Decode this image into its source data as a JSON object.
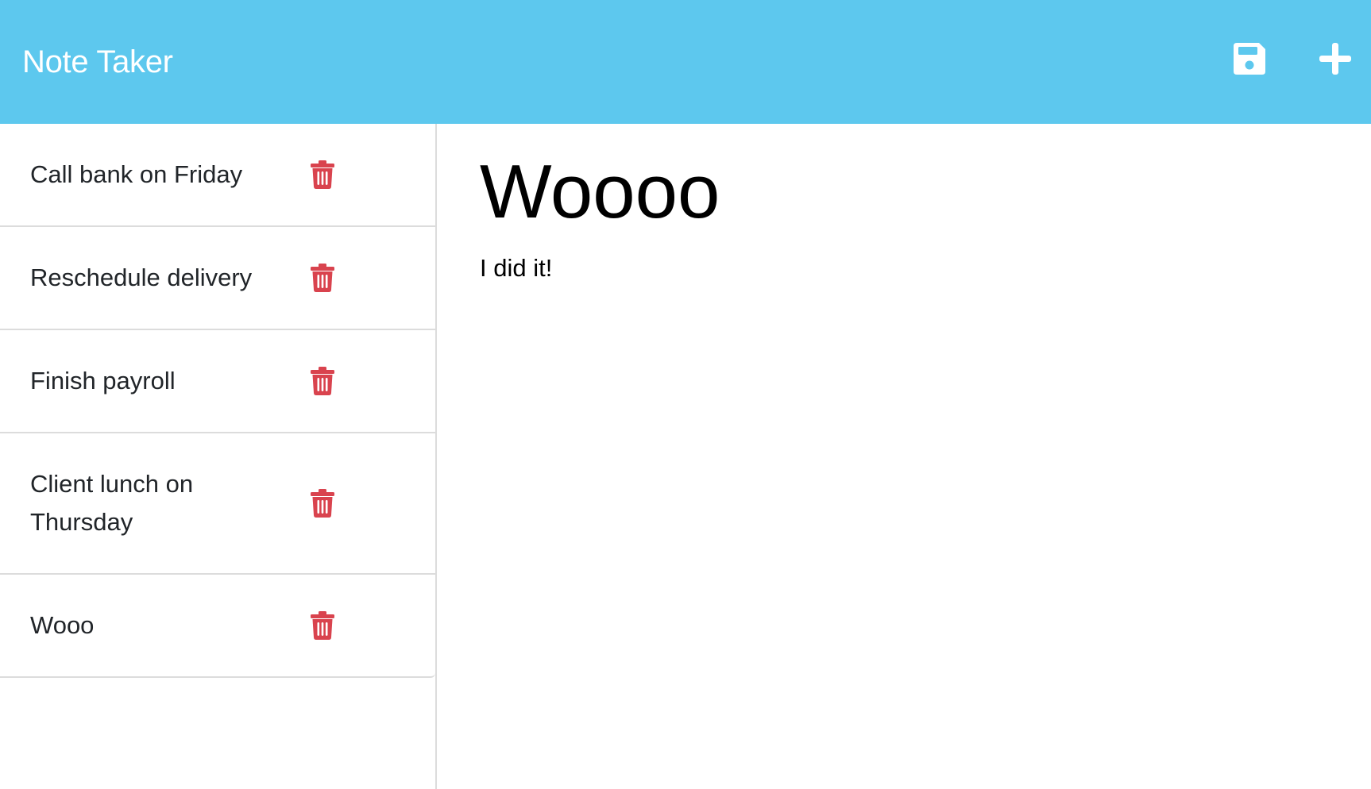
{
  "app": {
    "title": "Note Taker",
    "accent_color": "#5dc8ee",
    "delete_color": "#d9434e"
  },
  "toolbar": {
    "save_icon": "save-icon",
    "new_icon": "plus-icon"
  },
  "notes": [
    {
      "title": "Call bank on Friday"
    },
    {
      "title": "Reschedule delivery"
    },
    {
      "title": "Finish payroll"
    },
    {
      "title": "Client lunch on Thursday"
    },
    {
      "title": "Wooo"
    }
  ],
  "active_note": {
    "title": "Woooo",
    "text": "I did it!"
  }
}
